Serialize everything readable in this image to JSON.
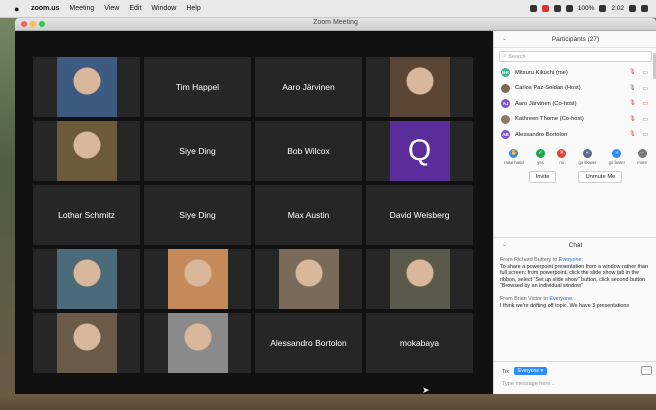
{
  "menubar": {
    "app": "zoom.us",
    "items": [
      "Meeting",
      "View",
      "Edit",
      "Window",
      "Help"
    ],
    "battery": "100%",
    "clock": "2:02"
  },
  "window": {
    "title": "Zoom Meeting"
  },
  "gallery": [
    {
      "name": "",
      "type": "video",
      "color": "#3d5a80"
    },
    {
      "name": "Tim Happel",
      "type": "name"
    },
    {
      "name": "Aaro Järvinen",
      "type": "name"
    },
    {
      "name": "",
      "type": "video",
      "color": "#5b4636"
    },
    {
      "name": "",
      "type": "video",
      "color": "#6b5b3a"
    },
    {
      "name": "Siye Ding",
      "type": "name"
    },
    {
      "name": "Bob Wilcox",
      "type": "name"
    },
    {
      "name": "Q",
      "type": "avatar",
      "color": "#5b2d9a"
    },
    {
      "name": "Lothar Schmitz",
      "type": "name"
    },
    {
      "name": "Siye Ding",
      "type": "name"
    },
    {
      "name": "Max Austin",
      "type": "name"
    },
    {
      "name": "David Weisberg",
      "type": "name"
    },
    {
      "name": "",
      "type": "video",
      "color": "#4a6a7a"
    },
    {
      "name": "",
      "type": "video",
      "color": "#c48a5a"
    },
    {
      "name": "",
      "type": "video",
      "color": "#7a6a5a"
    },
    {
      "name": "",
      "type": "video",
      "color": "#5a5a4a"
    },
    {
      "name": "",
      "type": "video",
      "color": "#6a5a4a"
    },
    {
      "name": "",
      "type": "video",
      "color": "#8a8a8a"
    },
    {
      "name": "Alessandro Bortolon",
      "type": "name"
    },
    {
      "name": "mokabaya",
      "type": "name"
    }
  ],
  "participants": {
    "title": "Participants (27)",
    "search_placeholder": "Search",
    "list": [
      {
        "name": "Mitsuru Kikuchi (me)",
        "initials": "MK",
        "color": "#3bb08f",
        "mic": "red",
        "cam": "grey"
      },
      {
        "name": "Carlos Paz-Soldan (Host)",
        "initials": "",
        "color": "#7a6a55",
        "mic": "grey",
        "cam": "grey"
      },
      {
        "name": "Aaro Järvinen (Co-host)",
        "initials": "AJ",
        "color": "#7b52c9",
        "mic": "red",
        "cam": "red"
      },
      {
        "name": "Kathreen Thome (Co-host)",
        "initials": "",
        "color": "#8a7a6a",
        "mic": "red",
        "cam": "grey"
      },
      {
        "name": "Alessandro Bortolon",
        "initials": "AB",
        "color": "#7b52c9",
        "mic": "red",
        "cam": "red"
      }
    ],
    "reactions": [
      {
        "label": "raise hand",
        "color": "#2d8cff",
        "glyph": "✋"
      },
      {
        "label": "yes",
        "color": "#1fa64a",
        "glyph": "✓"
      },
      {
        "label": "no",
        "color": "#e0453a",
        "glyph": "✕"
      },
      {
        "label": "go slower",
        "color": "#5a6a8a",
        "glyph": "«"
      },
      {
        "label": "go faster",
        "color": "#2d8cff",
        "glyph": "»"
      },
      {
        "label": "more",
        "color": "#777777",
        "glyph": "···"
      }
    ],
    "invite": "Invite",
    "unmute_me": "Unmute Me"
  },
  "chat": {
    "title": "Chat",
    "messages": [
      {
        "from": "From Richard Buttery to",
        "to": "Everyone:",
        "text": "To share a powerpoint presentation from a window rather than full screen: from powerpoint, click the slide show tab in the ribbon, select \"Set up slide show\" button, click second button \"Browsed by an individual window\""
      },
      {
        "from": "From Brian Victor to",
        "to": "Everyone:",
        "text": "I think we're drifting off topic. We have 3 presentations"
      }
    ],
    "to_label": "To:",
    "to_value": "Everyone ▾",
    "placeholder": "Type message here..."
  }
}
